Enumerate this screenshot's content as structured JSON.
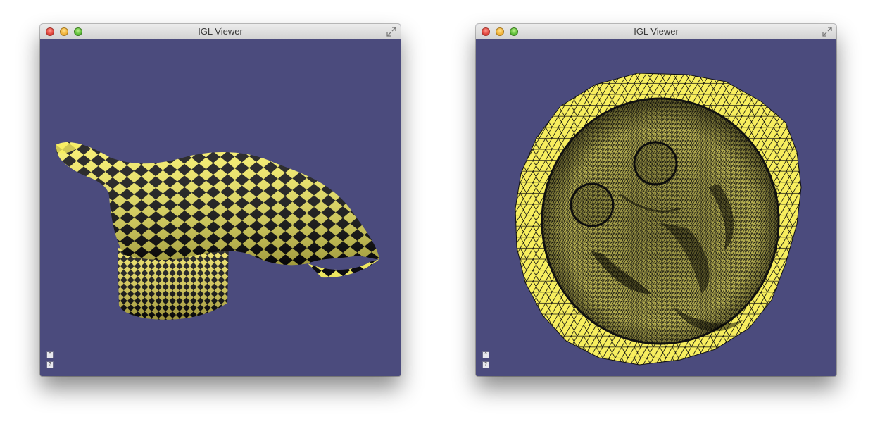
{
  "windows": [
    {
      "title": "IGL Viewer",
      "content": "checkerboard-textured 3D mesh",
      "buttons": [
        {
          "icon": "expand-panel-icon",
          "glyph": "⌃"
        },
        {
          "icon": "help-icon",
          "glyph": "?"
        }
      ]
    },
    {
      "title": "IGL Viewer",
      "content": "flattened triangle mesh parameterization",
      "buttons": [
        {
          "icon": "expand-panel-icon",
          "glyph": "⌃"
        },
        {
          "icon": "help-icon",
          "glyph": "?"
        }
      ]
    }
  ],
  "colors": {
    "viewport_bg": "#4b4b7d",
    "mesh_yellow": "#f7ee5e",
    "mesh_dark": "#0a0a0a"
  }
}
